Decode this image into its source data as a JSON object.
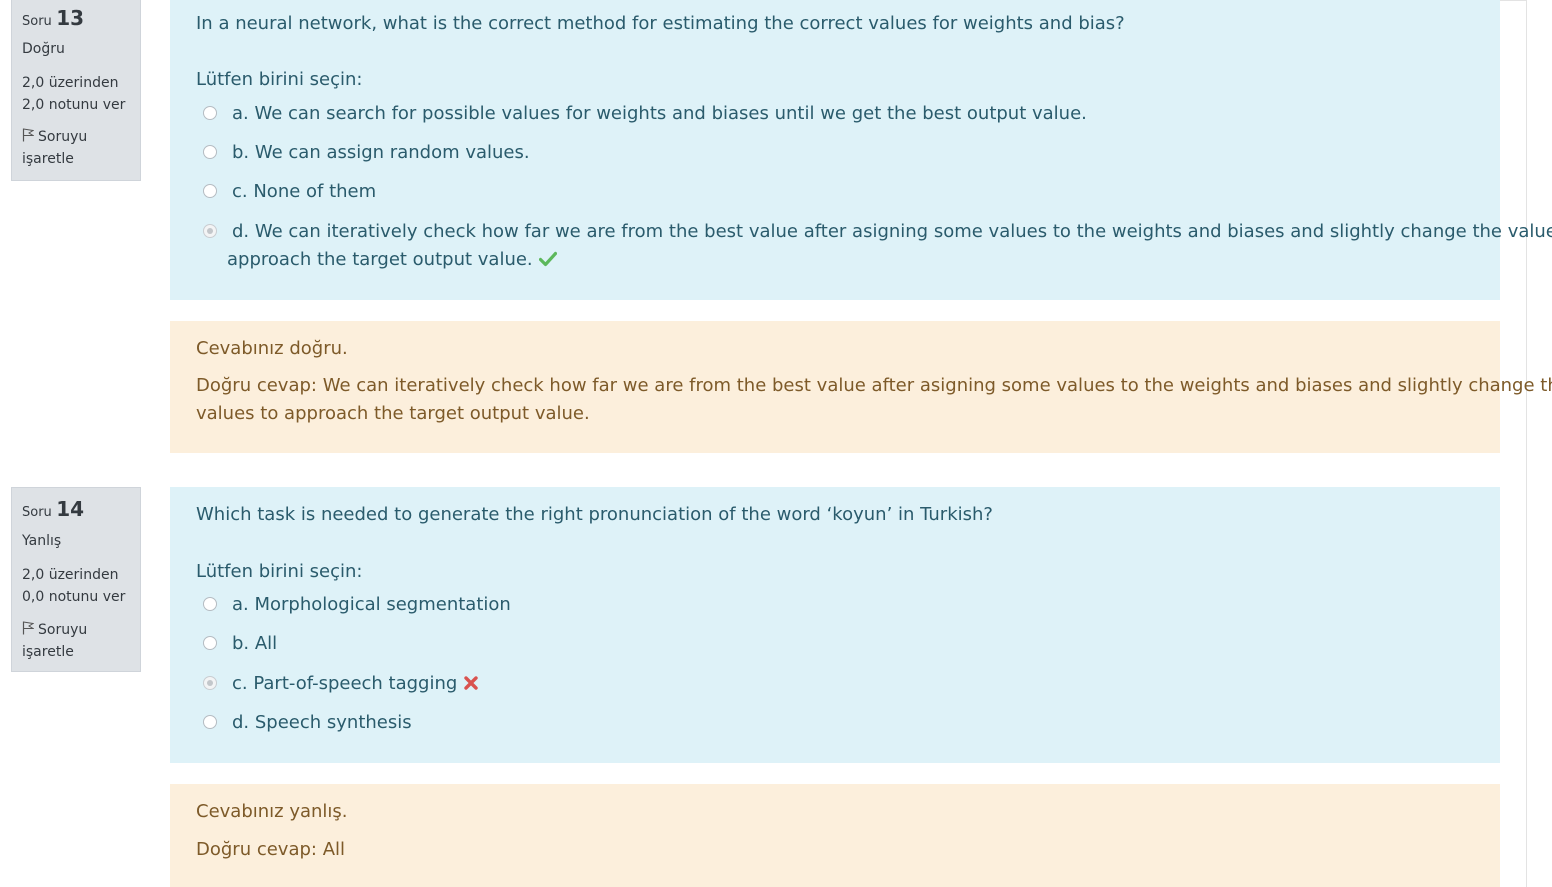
{
  "questions": [
    {
      "label": "Soru",
      "number": "13",
      "state": "Doğru",
      "grade_line1": "2,0 üzerinden",
      "grade_line2": "2,0 notunu ver",
      "flag_line1": "Soruyu",
      "flag_line2": "işaretle",
      "text": "In a neural network, what is the correct method for estimating the correct values for weights and bias?",
      "prompt": "Lütfen birini seçin:",
      "options": [
        {
          "text": "a. We can search for possible values for weights and biases until we get the best output value.",
          "selected": false
        },
        {
          "text": "b. We can assign random values.",
          "selected": false
        },
        {
          "text": "c. None of them",
          "selected": false
        },
        {
          "text": "d. We can iteratively check how far we are from the best value after asigning some values to the weights and biases and slightly change the values to",
          "text_cont": "approach the target output value.",
          "selected": true,
          "mark": "correct-check-icon"
        }
      ],
      "feedback_status": "Cevabınız doğru.",
      "feedback_answer_line1": "Doğru cevap: We can iteratively check how far we are from the best value after asigning some values to the weights and biases and slightly change the",
      "feedback_answer_line2": "values to approach the target output value."
    },
    {
      "label": "Soru",
      "number": "14",
      "state": "Yanlış",
      "grade_line1": "2,0 üzerinden",
      "grade_line2": "0,0 notunu ver",
      "flag_line1": "Soruyu",
      "flag_line2": "işaretle",
      "text": "Which task is needed to generate the right pronunciation of the word ‘koyun’ in Turkish?",
      "prompt": "Lütfen birini seçin:",
      "options": [
        {
          "text": "a. Morphological segmentation",
          "selected": false
        },
        {
          "text": "b. All",
          "selected": false
        },
        {
          "text": "c. Part-of-speech tagging",
          "selected": true,
          "mark": "incorrect-cross-icon"
        },
        {
          "text": "d. Speech synthesis",
          "selected": false
        }
      ],
      "feedback_status": "Cevabınız yanlış.",
      "feedback_answer_line1": "Doğru cevap: All"
    }
  ],
  "colors": {
    "info_bg": "#dee2e6",
    "formulation_bg": "#def2f8",
    "formulation_text": "#2a5b6c",
    "feedback_bg": "#fcefdc",
    "feedback_text": "#7d5a29",
    "correct": "#5cb85c",
    "incorrect": "#d9534f"
  }
}
